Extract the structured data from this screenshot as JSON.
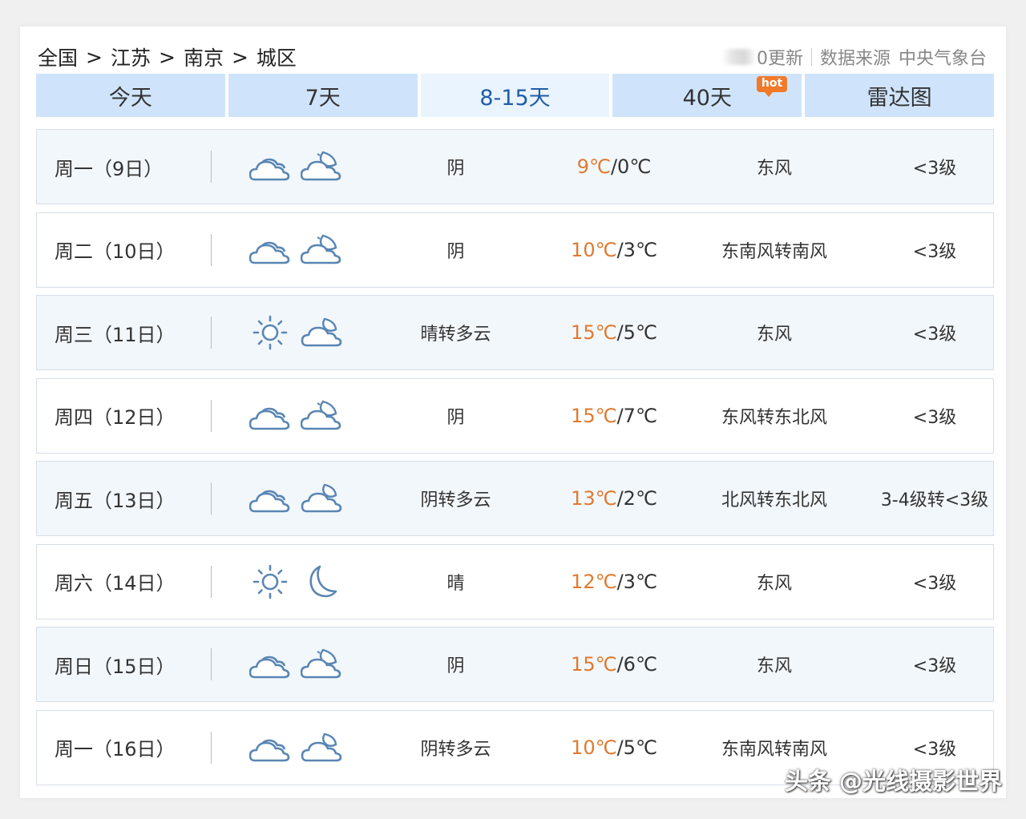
{
  "breadcrumb": [
    "全国",
    "江苏",
    "南京",
    "城区"
  ],
  "breadcrumb_sep": ">",
  "update_suffix": "0更新",
  "source_label": "数据来源",
  "source_value": "中央气象台",
  "tabs": [
    {
      "label": "今天",
      "active": false
    },
    {
      "label": "7天",
      "active": false
    },
    {
      "label": "8-15天",
      "active": true
    },
    {
      "label": "40天",
      "active": false,
      "badge": "hot"
    },
    {
      "label": "雷达图",
      "active": false
    }
  ],
  "forecast": [
    {
      "date": "周一（9日）",
      "day_icon": "cloud-icon",
      "night_icon": "cloud-moon-icon",
      "desc": "阴",
      "high": "9℃",
      "low": "0℃",
      "wind": "东风",
      "level": "<3级"
    },
    {
      "date": "周二（10日）",
      "day_icon": "cloud-icon",
      "night_icon": "cloud-moon-icon",
      "desc": "阴",
      "high": "10℃",
      "low": "3℃",
      "wind": "东南风转南风",
      "level": "<3级"
    },
    {
      "date": "周三（11日）",
      "day_icon": "sun-icon",
      "night_icon": "partly-cloudy-night-icon",
      "desc": "晴转多云",
      "high": "15℃",
      "low": "5℃",
      "wind": "东风",
      "level": "<3级"
    },
    {
      "date": "周四（12日）",
      "day_icon": "cloud-icon",
      "night_icon": "cloud-moon-icon",
      "desc": "阴",
      "high": "15℃",
      "low": "7℃",
      "wind": "东风转东北风",
      "level": "<3级"
    },
    {
      "date": "周五（13日）",
      "day_icon": "cloud-icon",
      "night_icon": "partly-cloudy-night-icon",
      "desc": "阴转多云",
      "high": "13℃",
      "low": "2℃",
      "wind": "北风转东北风",
      "level": "3-4级转<3级"
    },
    {
      "date": "周六（14日）",
      "day_icon": "sun-icon",
      "night_icon": "moon-icon",
      "desc": "晴",
      "high": "12℃",
      "low": "3℃",
      "wind": "东风",
      "level": "<3级"
    },
    {
      "date": "周日（15日）",
      "day_icon": "cloud-icon",
      "night_icon": "cloud-moon-icon",
      "desc": "阴",
      "high": "15℃",
      "low": "6℃",
      "wind": "东风",
      "level": "<3级"
    },
    {
      "date": "周一（16日）",
      "day_icon": "cloud-icon",
      "night_icon": "partly-cloudy-night-icon",
      "desc": "阴转多云",
      "high": "10℃",
      "low": "5℃",
      "wind": "东南风转南风",
      "level": "<3级"
    }
  ],
  "colors": {
    "accent": "#1f5da8",
    "high_temp": "#e07a2e",
    "tab_bg": "#cfe4fa",
    "icon_stroke": "#5a86b3"
  },
  "watermark": "头条 @光线摄影世界"
}
